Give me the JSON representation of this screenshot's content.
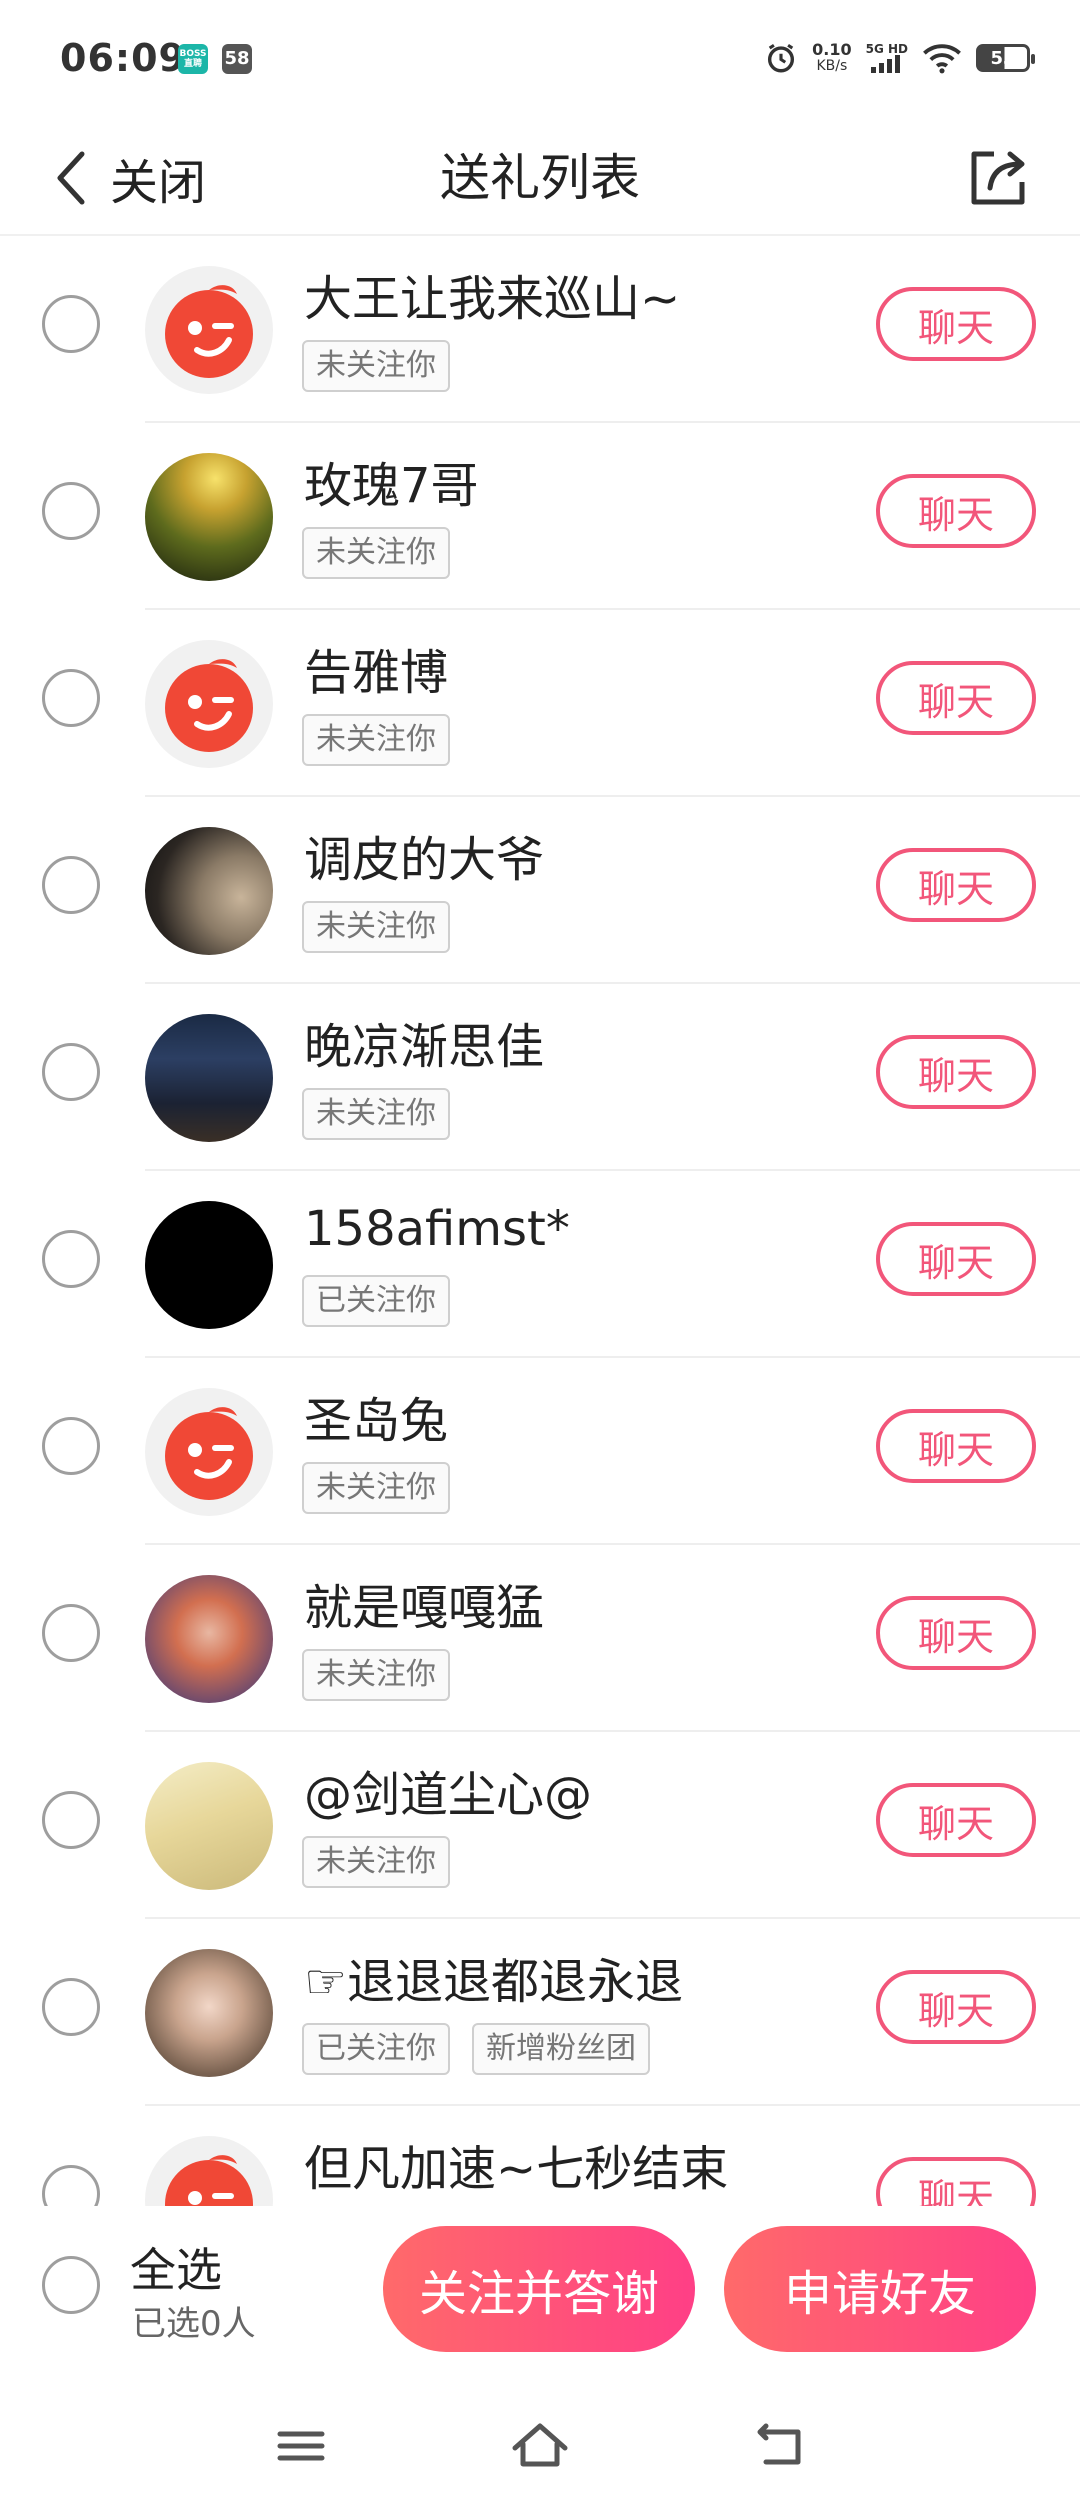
{
  "status_bar": {
    "time": "06:09",
    "app_badge_1": "BOSS直聘",
    "app_badge_2": "58",
    "net_speed": "0.10",
    "net_unit": "KB/s",
    "network": "5G HD",
    "battery": "53"
  },
  "header": {
    "back_label": "关闭",
    "title": "送礼列表"
  },
  "list": {
    "chat_label": "聊天",
    "items": [
      {
        "name": "大王让我来巡山~",
        "tags": [
          "未关注你"
        ],
        "avatar": "app-logo"
      },
      {
        "name": "玫瑰7哥",
        "tags": [
          "未关注你"
        ],
        "avatar": "forest-photo"
      },
      {
        "name": "告雅博",
        "tags": [
          "未关注你"
        ],
        "avatar": "app-logo"
      },
      {
        "name": "调皮的大爷",
        "tags": [
          "未关注你"
        ],
        "avatar": "cat-photo"
      },
      {
        "name": "晚凉渐思佳",
        "tags": [
          "未关注你"
        ],
        "avatar": "sign-photo"
      },
      {
        "name": "158afimst*",
        "tags": [
          "已关注你"
        ],
        "avatar": "black"
      },
      {
        "name": "圣岛兔",
        "tags": [
          "未关注你"
        ],
        "avatar": "app-logo"
      },
      {
        "name": "就是嘎嘎猛",
        "tags": [
          "未关注你"
        ],
        "avatar": "girl-photo"
      },
      {
        "name": "@剑道尘心@",
        "tags": [
          "未关注你"
        ],
        "avatar": "cartoon-photo"
      },
      {
        "name": "☞退退退都退永退",
        "tags": [
          "已关注你",
          "新增粉丝团"
        ],
        "avatar": "selfie-photo"
      },
      {
        "name": "但凡加速~七秒结束",
        "tags": [],
        "avatar": "app-logo"
      }
    ]
  },
  "action_bar": {
    "select_all": "全选",
    "selected_count": "已选0人",
    "follow_thank": "关注并答谢",
    "add_friend": "申请好友"
  },
  "colors": {
    "accent": "#f2567a",
    "gradient_start": "#ff6a6a",
    "gradient_end": "#ff3f86",
    "logo_red": "#f04836"
  }
}
